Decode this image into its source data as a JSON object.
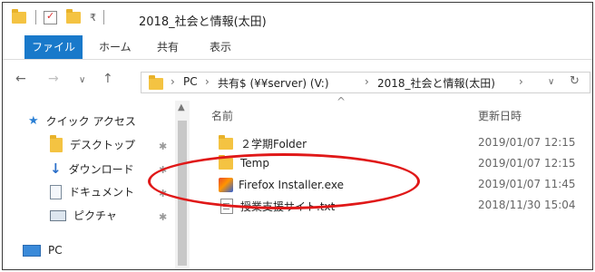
{
  "window": {
    "title": "2018_社会と情報(太田)"
  },
  "ribbon": {
    "tabs": [
      "ファイル",
      "ホーム",
      "共有",
      "表示"
    ]
  },
  "address": {
    "crumbs": [
      "PC",
      "共有$ (¥¥server) (V:)",
      "2018_社会と情報(太田)"
    ],
    "dropdown_glyph": "∨",
    "refresh_glyph": "↻"
  },
  "nav": {
    "items": [
      {
        "label": "クイック アクセス",
        "icon": "star-icon"
      },
      {
        "label": "デスクトップ",
        "icon": "folder-icon"
      },
      {
        "label": "ダウンロード",
        "icon": "download-icon"
      },
      {
        "label": "ドキュメント",
        "icon": "document-icon"
      },
      {
        "label": "ピクチャ",
        "icon": "picture-icon"
      },
      {
        "label": "PC",
        "icon": "pc-icon"
      }
    ]
  },
  "list": {
    "headers": {
      "name": "名前",
      "date": "更新日時"
    },
    "rows": [
      {
        "name": "２学期Folder",
        "date": "2019/01/07 12:15",
        "type": "folder"
      },
      {
        "name": "Temp",
        "date": "2019/01/07 12:15",
        "type": "folder"
      },
      {
        "name": "Firefox Installer.exe",
        "date": "2019/01/07 11:45",
        "type": "exe"
      },
      {
        "name": "授業支援サイト.txt",
        "date": "2018/11/30 15:04",
        "type": "txt"
      }
    ]
  },
  "colors": {
    "file_tab": "#1979ca",
    "highlight_oval": "#e01818",
    "folder": "#f4c342"
  }
}
